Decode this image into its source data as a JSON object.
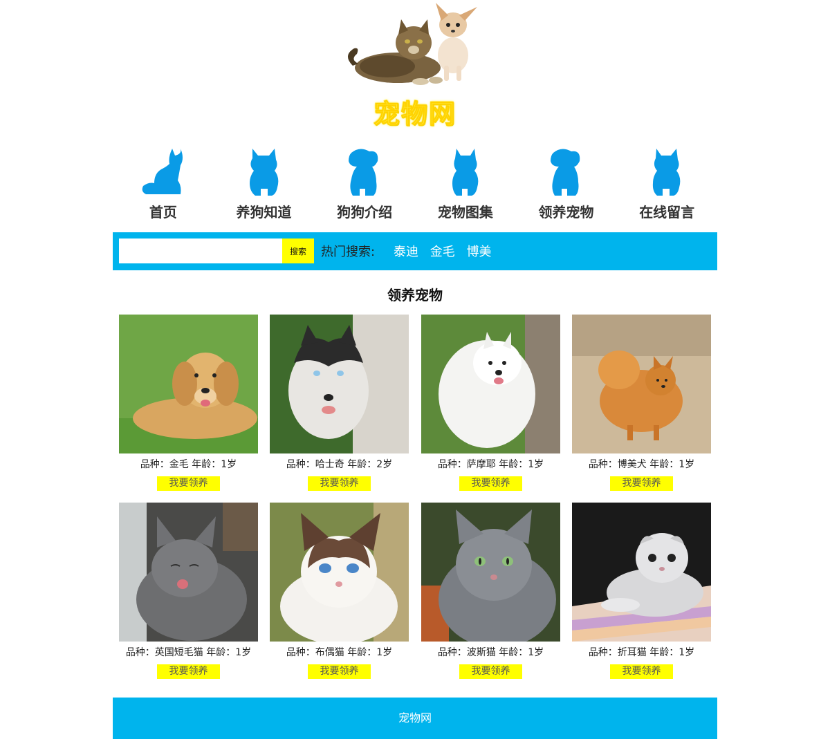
{
  "header": {
    "site_title": "宠物网"
  },
  "nav": {
    "items": [
      {
        "label": "首页",
        "icon": "cat-silhouette-icon"
      },
      {
        "label": "养狗知道",
        "icon": "kitten-silhouette-icon"
      },
      {
        "label": "狗狗介绍",
        "icon": "puppy-silhouette-icon"
      },
      {
        "label": "宠物图集",
        "icon": "kitten-silhouette-icon"
      },
      {
        "label": "领养宠物",
        "icon": "puppy-silhouette-icon"
      },
      {
        "label": "在线留言",
        "icon": "kitten-silhouette-icon"
      }
    ],
    "icon_color": "#0a9be6"
  },
  "search": {
    "value": "",
    "button_label": "搜索",
    "hot_label": "热门搜索:",
    "hot_links": [
      "泰迪",
      "金毛",
      "博美"
    ],
    "bar_color": "#00b4ed"
  },
  "main": {
    "section_title": "领养宠物",
    "adopt_label": "我要领养",
    "pets": [
      {
        "info": "品种：金毛 年龄：1岁",
        "photo": "golden-retriever-photo"
      },
      {
        "info": "品种：哈士奇 年龄：2岁",
        "photo": "husky-photo"
      },
      {
        "info": "品种：萨摩耶 年龄：1岁",
        "photo": "samoyed-photo"
      },
      {
        "info": "品种：博美犬 年龄：1岁",
        "photo": "pomeranian-photo"
      },
      {
        "info": "品种：英国短毛猫 年龄：1岁",
        "photo": "british-shorthair-photo"
      },
      {
        "info": "品种：布偶猫 年龄：1岁",
        "photo": "ragdoll-photo"
      },
      {
        "info": "品种：波斯猫 年龄：1岁",
        "photo": "persian-cat-photo"
      },
      {
        "info": "品种：折耳猫 年龄：1岁",
        "photo": "scottish-fold-photo"
      }
    ]
  },
  "footer": {
    "text": "宠物网"
  }
}
